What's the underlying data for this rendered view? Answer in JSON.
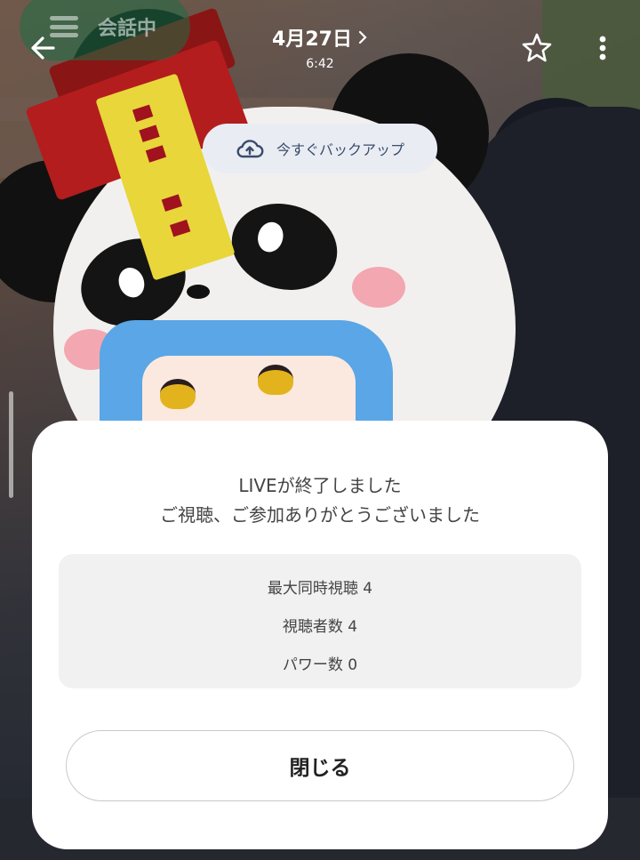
{
  "header": {
    "chat_status": "会話中",
    "date": "4月27日",
    "time": "6:42"
  },
  "backup": {
    "label": "今すぐバックアップ"
  },
  "live_end": {
    "title_line1": "LIVEが終了しました",
    "title_line2": "ご視聴、ご参加ありがとうございました",
    "stats": [
      {
        "label": "最大同時視聴",
        "value": "4"
      },
      {
        "label": "視聴者数",
        "value": "4"
      },
      {
        "label": "パワー数",
        "value": "0"
      }
    ],
    "close_label": "閉じる"
  },
  "icons": {
    "back": "arrow-left-icon",
    "date_more": "chevron-right-icon",
    "favorite": "star-outline-icon",
    "more": "more-vertical-icon",
    "backup": "cloud-upload-icon",
    "chat": "menu-icon"
  },
  "colors": {
    "sheet_bg": "#ffffff",
    "stats_bg": "#f1f1f1",
    "backup_bg": "#e9edf3",
    "backup_text": "#3a4c6a",
    "chat_pill": "#1e6e46"
  }
}
